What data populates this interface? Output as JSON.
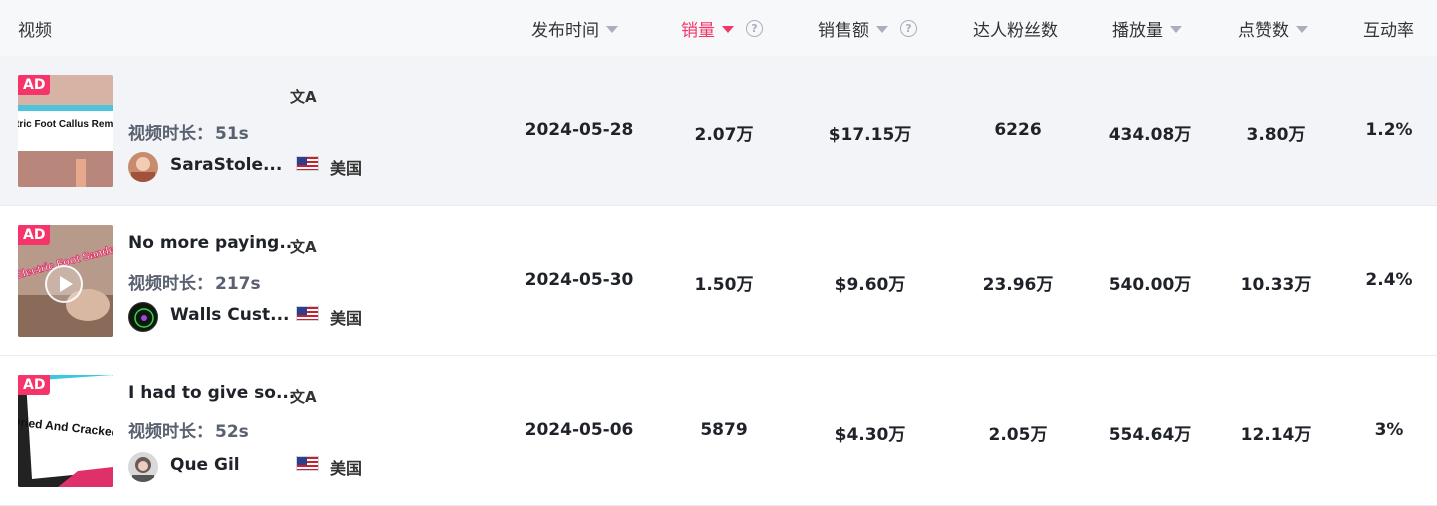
{
  "header": {
    "video": "视频",
    "publish_time": "发布时间",
    "sales": "销量",
    "revenue": "销售额",
    "followers": "达人粉丝数",
    "views": "播放量",
    "likes": "点赞数",
    "engagement": "互动率",
    "help": "?"
  },
  "rows": [
    {
      "ad_badge": "AD",
      "thumb_text": "Electric Foot Callus Remover",
      "title": "",
      "translate_icon": "文A",
      "duration_label": "视频时长：",
      "duration": "51s",
      "author": "SaraStole...",
      "country": "美国",
      "date": "2024-05-28",
      "sales": "2.07万",
      "revenue": "$17.15万",
      "followers": "6226",
      "views": "434.08万",
      "likes": "3.80万",
      "engagement": "1.2%"
    },
    {
      "ad_badge": "AD",
      "thumb_text": "Electric Foot Sander",
      "title": "No more paying...",
      "translate_icon": "文A",
      "duration_label": "视频时长：",
      "duration": "217s",
      "author": "Walls Cust...",
      "country": "美国",
      "date": "2024-05-30",
      "sales": "1.50万",
      "revenue": "$9.60万",
      "followers": "23.96万",
      "views": "540.00万",
      "likes": "10.33万",
      "engagement": "2.4%"
    },
    {
      "ad_badge": "AD",
      "thumb_text": "Dried And Cracked",
      "title": "I had to give so...",
      "translate_icon": "文A",
      "duration_label": "视频时长：",
      "duration": "52s",
      "author": "Que  Gil",
      "country": "美国",
      "date": "2024-05-06",
      "sales": "5879",
      "revenue": "$4.30万",
      "followers": "2.05万",
      "views": "554.64万",
      "likes": "12.14万",
      "engagement": "3%"
    }
  ],
  "colors": {
    "accent": "#f5356a",
    "header_bg": "#f7f8fa",
    "hover_bg": "#f3f4f7"
  }
}
